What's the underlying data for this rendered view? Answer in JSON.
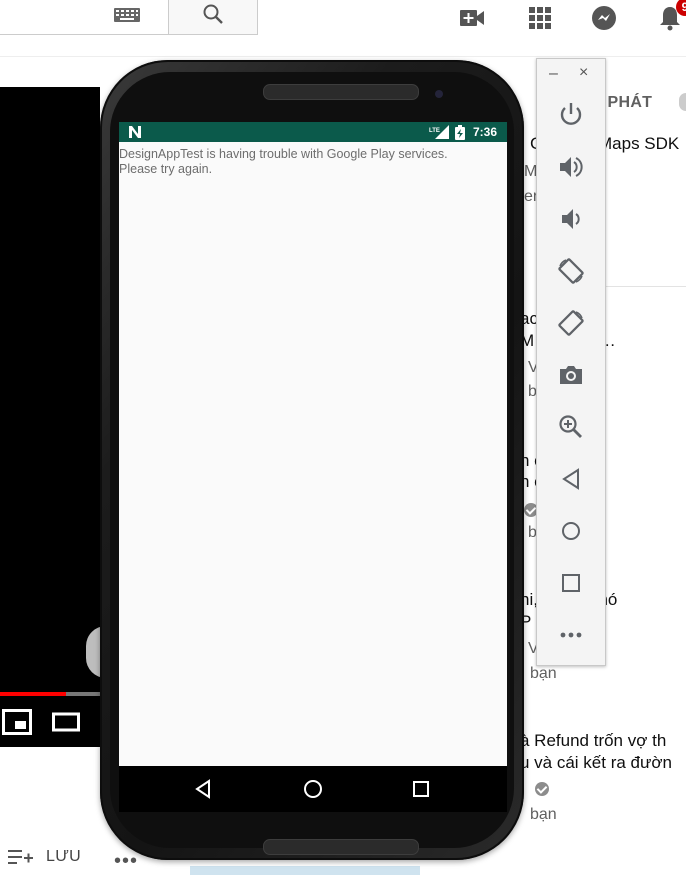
{
  "youtube": {
    "header": {
      "keyboard_icon": "keyboard-icon",
      "search_icon": "search-icon",
      "create_icon": "video-camera-plus-icon",
      "apps_icon": "apps-grid-icon",
      "messages_icon": "messages-icon",
      "notifications_icon": "bell-icon",
      "notification_count": "9"
    },
    "autoplay_label": "G PHÁT",
    "sidebar": [
      {
        "line1": "Maps SDK",
        "meta": "M",
        "meta2": "er"
      },
      {
        "line1": "ac       iúp Bạn",
        "line2": "M        Rank\" »…",
        "meta": "V",
        "meta2": "bạ"
      },
      {
        "line1": "n        o tại sao",
        "line2": "n          er",
        "meta2": "b"
      },
      {
        "line1": "ni,     nghiện nó",
        "line2": "P        G BẢN…",
        "meta": "V",
        "meta2": "bạn"
      },
      {
        "line1": "à Refund trốn vợ th",
        "line2": "u và cái kết ra đườn",
        "meta2": "bạn"
      }
    ],
    "save_label": "LƯU",
    "more_label": "•••"
  },
  "phone": {
    "status": {
      "time": "7:36"
    },
    "toast": {
      "line1": "DesignAppTest is having trouble with Google Play services.",
      "line2": "Please try again."
    },
    "nav": {
      "back": "back-icon",
      "home": "home-icon",
      "recents": "recents-icon"
    }
  },
  "toolbar": {
    "minimize": "–",
    "close": "×",
    "buttons": [
      "power",
      "volume-up",
      "volume-down",
      "rotate-left",
      "rotate-right",
      "screenshot",
      "zoom",
      "back",
      "home",
      "overview",
      "more"
    ]
  },
  "colors": {
    "status_bar": "#0b5a4b",
    "progress": "#ff0000",
    "toolbar_icon": "#5f6368"
  }
}
